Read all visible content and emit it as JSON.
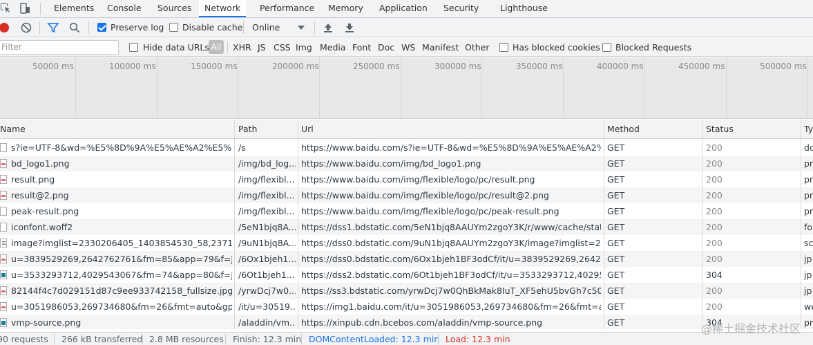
{
  "tabs": [
    "Elements",
    "Console",
    "Sources",
    "Network",
    "Performance",
    "Memory",
    "Application",
    "Security",
    "Lighthouse"
  ],
  "toolbar": {
    "preserve_log": "Preserve log",
    "disable_cache": "Disable cache",
    "throttle": "Online",
    "preserve_log_checked": true,
    "disable_cache_checked": false
  },
  "filterbar": {
    "placeholder": "Filter",
    "hide_data_urls": "Hide data URLs",
    "all": "All",
    "types": [
      "XHR",
      "JS",
      "CSS",
      "Img",
      "Media",
      "Font",
      "Doc",
      "WS",
      "Manifest",
      "Other"
    ],
    "blocked_cookies": "Has blocked cookies",
    "blocked_requests": "Blocked Requests"
  },
  "timeline": {
    "ticks": [
      "50000 ms",
      "100000 ms",
      "150000 ms",
      "200000 ms",
      "250000 ms",
      "300000 ms",
      "350000 ms",
      "400000 ms",
      "450000 ms",
      "500000 ms"
    ]
  },
  "table": {
    "columns": [
      "Name",
      "Path",
      "Url",
      "Method",
      "Status",
      "Ty"
    ],
    "rows": [
      {
        "name": "s?ie=UTF-8&wd=%E5%8D%9A%E5%AE%A2%E5%9B...",
        "path": "/s",
        "url": "https://www.baidu.com/s?ie=UTF-8&wd=%E5%8D%9A%E5%AE%A2%E5...",
        "method": "GET",
        "status": "200",
        "type": "dc",
        "icon": "doc"
      },
      {
        "name": "bd_logo1.png",
        "path": "/img/bd_log...",
        "url": "https://www.baidu.com/img/bd_logo1.png",
        "method": "GET",
        "status": "200",
        "type": "pr",
        "icon": "img"
      },
      {
        "name": "result.png",
        "path": "/img/flexibl...",
        "url": "https://www.baidu.com/img/flexible/logo/pc/result.png",
        "method": "GET",
        "status": "200",
        "type": "pr",
        "icon": "img"
      },
      {
        "name": "result@2.png",
        "path": "/img/flexibl...",
        "url": "https://www.baidu.com/img/flexible/logo/pc/result@2.png",
        "method": "GET",
        "status": "200",
        "type": "pr",
        "icon": "img"
      },
      {
        "name": "peak-result.png",
        "path": "/img/flexibl...",
        "url": "https://www.baidu.com/img/flexible/logo/pc/peak-result.png",
        "method": "GET",
        "status": "200",
        "type": "pr",
        "icon": "doc"
      },
      {
        "name": "iconfont.woff2",
        "path": "/5eN1bjq8A...",
        "url": "https://dss1.bdstatic.com/5eN1bjq8AAUYm2zgoY3K/r/www/cache/static...",
        "method": "GET",
        "status": "200",
        "type": "fo",
        "icon": "doc"
      },
      {
        "name": "image?imglist=2330206405_1403854530_58,237117...",
        "path": "/9uN1bjq8A...",
        "url": "https://dss0.bdstatic.com/9uN1bjq8AAUYm2zgoY3K/image?imglist=233...",
        "method": "GET",
        "status": "200",
        "type": "sc",
        "icon": "font"
      },
      {
        "name": "u=3839529269,2642762761&fm=85&app=79&f=JP...",
        "path": "/6Ox1bjeh1...",
        "url": "https://dss0.bdstatic.com/6Ox1bjeh1BF3odCf/it/u=3839529269,2642762...",
        "method": "GET",
        "status": "200",
        "type": "jp",
        "icon": "img"
      },
      {
        "name": "u=3533293712,4029543067&fm=74&app=80&f=JPE...",
        "path": "/6Ot1bjeh1...",
        "url": "https://dss2.bdstatic.com/6Ot1bjeh1BF3odCf/it/u=3533293712,4029543...",
        "method": "GET",
        "status": "304",
        "type": "jp",
        "icon": "img2"
      },
      {
        "name": "82144f4c7d029151d87c9ee933742158_fullsize.jpg",
        "path": "/yrwDcj7w0...",
        "url": "https://ss3.bdstatic.com/yrwDcj7w0QhBkMak8IuT_XF5ehU5bvGh7c50/lo...",
        "method": "GET",
        "status": "200",
        "type": "jp",
        "icon": "img"
      },
      {
        "name": "u=3051986053,269734680&fm=26&fmt=auto&gp=...",
        "path": "/it/u=30519...",
        "url": "https://img1.baidu.com/it/u=3051986053,269734680&fm=26&fmt=aut...",
        "method": "GET",
        "status": "200",
        "type": "we",
        "icon": "img"
      },
      {
        "name": "vmp-source.png",
        "path": "/aladdin/vm...",
        "url": "https://xinpub.cdn.bcebos.com/aladdin/vmp-source.png",
        "method": "GET",
        "status": "304",
        "type": "pr",
        "icon": "img2"
      }
    ]
  },
  "statusbar": {
    "requests": "90 requests",
    "transferred": "266 kB transferred",
    "resources": "2.8 MB resources",
    "finish": "Finish: 12.3 min",
    "dcl": "DOMContentLoaded: 12.3 min",
    "load": "Load: 12.3 min"
  },
  "watermark": "@稀土掘金技术社区",
  "colors": {
    "accent": "#1a73e8",
    "record": "#d93025",
    "load": "#d93025"
  }
}
